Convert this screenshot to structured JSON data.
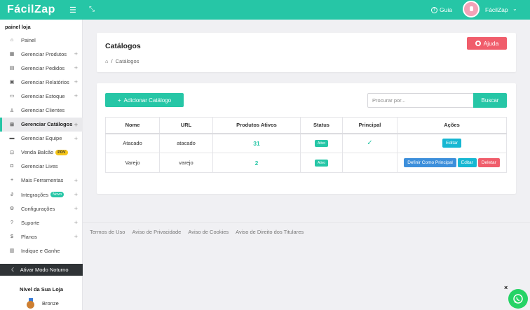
{
  "topbar": {
    "logo": "FácilZap",
    "menu_icon": "hamburger-icon",
    "expand_icon": "expand-icon",
    "guide_label": "Guia",
    "user_label": "FácilZap",
    "colors": {
      "primary": "#26c6a6"
    }
  },
  "sidebar": {
    "store_label": "painel loja",
    "items": [
      {
        "label": "Painel",
        "icon": "home-icon",
        "expandable": false
      },
      {
        "label": "Gerenciar Produtos",
        "icon": "box-icon",
        "expandable": true
      },
      {
        "label": "Gerenciar Pedidos",
        "icon": "receipt-icon",
        "expandable": true
      },
      {
        "label": "Gerenciar Relatórios",
        "icon": "calendar-icon",
        "expandable": true
      },
      {
        "label": "Gerenciar Estoque",
        "icon": "archive-icon",
        "expandable": true
      },
      {
        "label": "Gerenciar Clientes",
        "icon": "user-icon",
        "expandable": false
      },
      {
        "label": "Gerenciar Catálogos",
        "icon": "grid-icon",
        "expandable": true,
        "active": true
      },
      {
        "label": "Gerenciar Equipe",
        "icon": "briefcase-icon",
        "expandable": true
      },
      {
        "label": "Venda Balcão",
        "icon": "cart-icon",
        "expandable": false,
        "badge": "PDV"
      },
      {
        "label": "Gerenciar Lives",
        "icon": "camera-icon",
        "expandable": false
      },
      {
        "label": "Mais Ferramentas",
        "icon": "plus-icon",
        "expandable": true
      },
      {
        "label": "Integrações",
        "icon": "plug-icon",
        "expandable": true,
        "badge": "Novo"
      },
      {
        "label": "Configurações",
        "icon": "gear-icon",
        "expandable": true
      },
      {
        "label": "Suporte",
        "icon": "help-icon",
        "expandable": true
      },
      {
        "label": "Planos",
        "icon": "dollar-icon",
        "expandable": true
      },
      {
        "label": "Indique e Ganhe",
        "icon": "gift-icon",
        "expandable": false
      }
    ],
    "night_mode_label": "Ativar Modo Noturno",
    "level_title": "Nível da Sua Loja",
    "level_value": "Bronze"
  },
  "header": {
    "title": "Catálogos",
    "breadcrumb_current": "Catálogos",
    "help_label": "Ajuda"
  },
  "toolbar": {
    "add_label": "Adicionar Catálogo",
    "search_placeholder": "Procurar por...",
    "search_button": "Buscar"
  },
  "table": {
    "columns": [
      "Nome",
      "URL",
      "Produtos Ativos",
      "Status",
      "Principal",
      "Ações"
    ],
    "rows": [
      {
        "name": "Atacado",
        "url": "atacado",
        "active_products": "31",
        "status": "Ativo",
        "principal": true,
        "actions": [
          "Editar"
        ]
      },
      {
        "name": "Varejo",
        "url": "varejo",
        "active_products": "2",
        "status": "Ativo",
        "principal": false,
        "actions": [
          "Definir Como Principal",
          "Editar",
          "Deletar"
        ]
      }
    ]
  },
  "footer": {
    "links": [
      "Termos de Uso",
      "Aviso de Privacidade",
      "Aviso de Cookies",
      "Aviso de Direito dos Titulares"
    ]
  },
  "widget": {
    "close_label": "×",
    "chat_icon": "whatsapp-icon"
  }
}
